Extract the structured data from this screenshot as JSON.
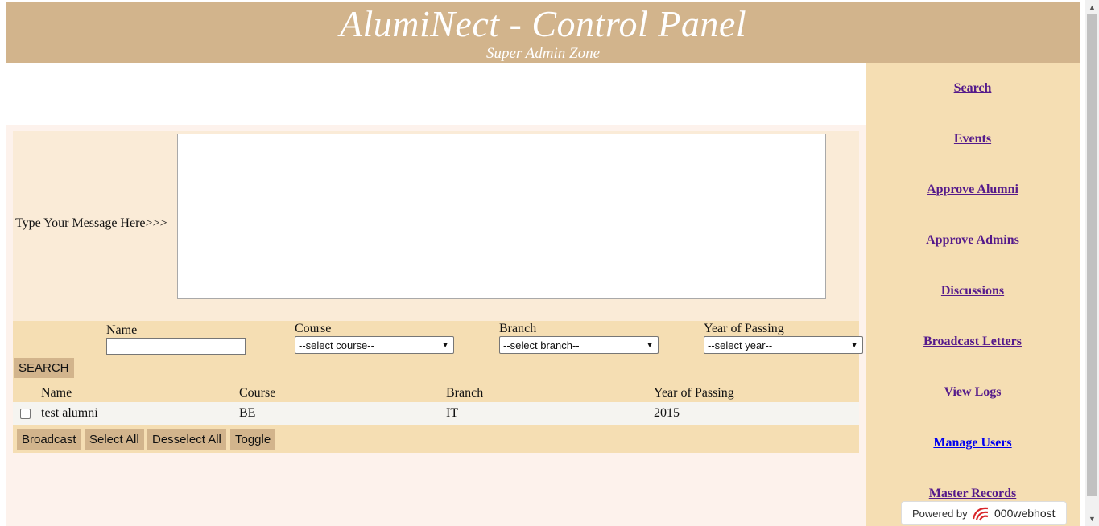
{
  "header": {
    "title": "AlumiNect - Control Panel",
    "subtitle": "Super Admin Zone"
  },
  "sidebar": {
    "items": [
      {
        "label": "Search"
      },
      {
        "label": "Events"
      },
      {
        "label": "Approve Alumni"
      },
      {
        "label": "Approve Admins"
      },
      {
        "label": "Discussions"
      },
      {
        "label": "Broadcast Letters"
      },
      {
        "label": "View Logs"
      },
      {
        "label": "Manage Users"
      },
      {
        "label": "Master Records"
      }
    ]
  },
  "message": {
    "label": "Type Your Message Here>>>",
    "value": ""
  },
  "filters": {
    "name_label": "Name",
    "name_value": "",
    "course_label": "Course",
    "course_selected": "--select course--",
    "branch_label": "Branch",
    "branch_selected": "--select branch--",
    "year_label": "Year of Passing",
    "year_selected": "--select year--",
    "search_button": "SEARCH"
  },
  "table": {
    "columns": [
      "Name",
      "Course",
      "Branch",
      "Year of Passing"
    ],
    "rows": [
      {
        "name": "test alumni",
        "course": "BE",
        "branch": "IT",
        "year": "2015",
        "checked": false
      }
    ]
  },
  "actions": {
    "broadcast": "Broadcast",
    "select_all": "Select All",
    "deselect_all": "Desselect All",
    "toggle": "Toggle"
  },
  "badge": {
    "powered_by": "Powered by",
    "host": "000webhost"
  },
  "colors": {
    "header_bg": "#d2b48c",
    "sidebar_bg": "#f5deb3",
    "visited_link": "#551a8b",
    "unvisited_link": "#0000ee"
  }
}
